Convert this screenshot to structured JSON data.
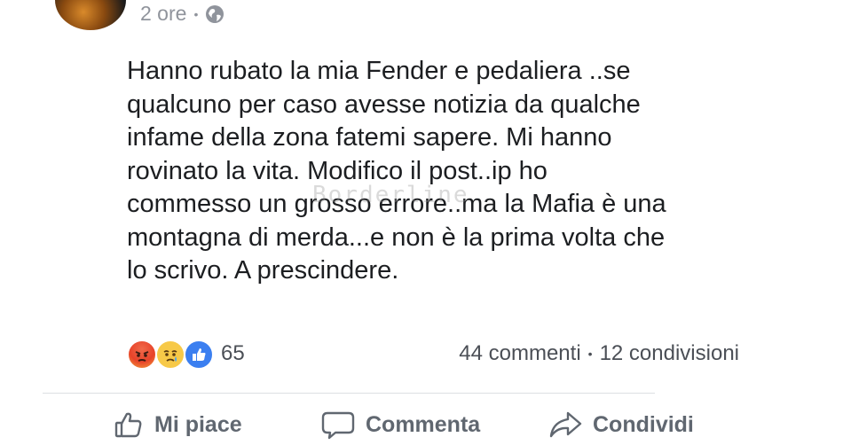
{
  "post": {
    "time": "2 ore",
    "privacy_icon": "globe-icon",
    "text": "Hanno rubato la mia Fender e pedaliera  ..se\nqualcuno per caso avesse notizia da qualche\ninfame della zona fatemi sapere. Mi hanno\nrovinato la vita. Modifico il post..ip ho\ncommesso un grosso errore..ma la Mafia è una\nmontagna di merda...e non è la prima volta che\nlo scrivo. A prescindere.",
    "watermark": "Borderline"
  },
  "reactions": {
    "icons": [
      "angry-reaction-icon",
      "sad-reaction-icon",
      "like-reaction-icon"
    ],
    "count": "65",
    "comments": "44 commenti",
    "shares": "12 condivisioni"
  },
  "actions": {
    "like_label": "Mi piace",
    "comment_label": "Commenta",
    "share_label": "Condividi"
  },
  "colors": {
    "like_blue": "#3b7ff0",
    "angry_red": "#e8432a",
    "sad_yellow": "#f7c948",
    "muted_text": "#90949c"
  }
}
